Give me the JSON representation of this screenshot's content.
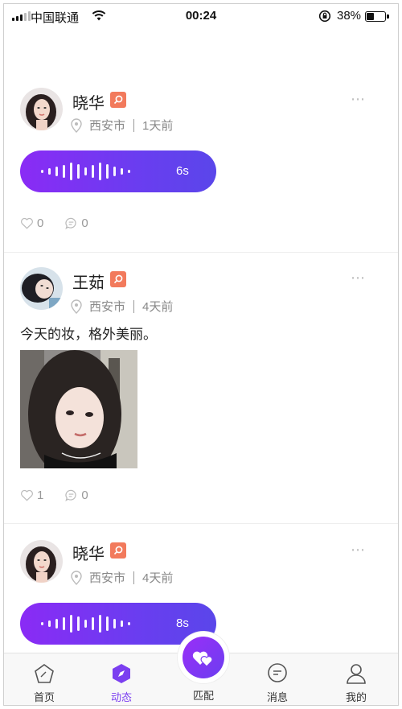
{
  "status_bar": {
    "carrier": "中国联通",
    "time": "00:24",
    "battery": "38%"
  },
  "posts": [
    {
      "name": "晓华",
      "location": "西安市",
      "time_ago": "1天前",
      "voice_duration": "6s",
      "likes": "0",
      "comments": "0"
    },
    {
      "name": "王茹",
      "location": "西安市",
      "time_ago": "4天前",
      "text": "今天的妆，格外美丽。",
      "likes": "1",
      "comments": "0"
    },
    {
      "name": "晓华",
      "location": "西安市",
      "time_ago": "4天前",
      "voice_duration": "8s"
    }
  ],
  "more_icon": "⋯",
  "tabbar": {
    "home": "首页",
    "feed": "动态",
    "match": "匹配",
    "messages": "消息",
    "mine": "我的",
    "active": "feed",
    "accent": "#7b3ff0"
  },
  "colors": {
    "voice_gradient_start": "#8a2bf5",
    "voice_gradient_end": "#5a46ea",
    "badge": "#f27a5c"
  }
}
